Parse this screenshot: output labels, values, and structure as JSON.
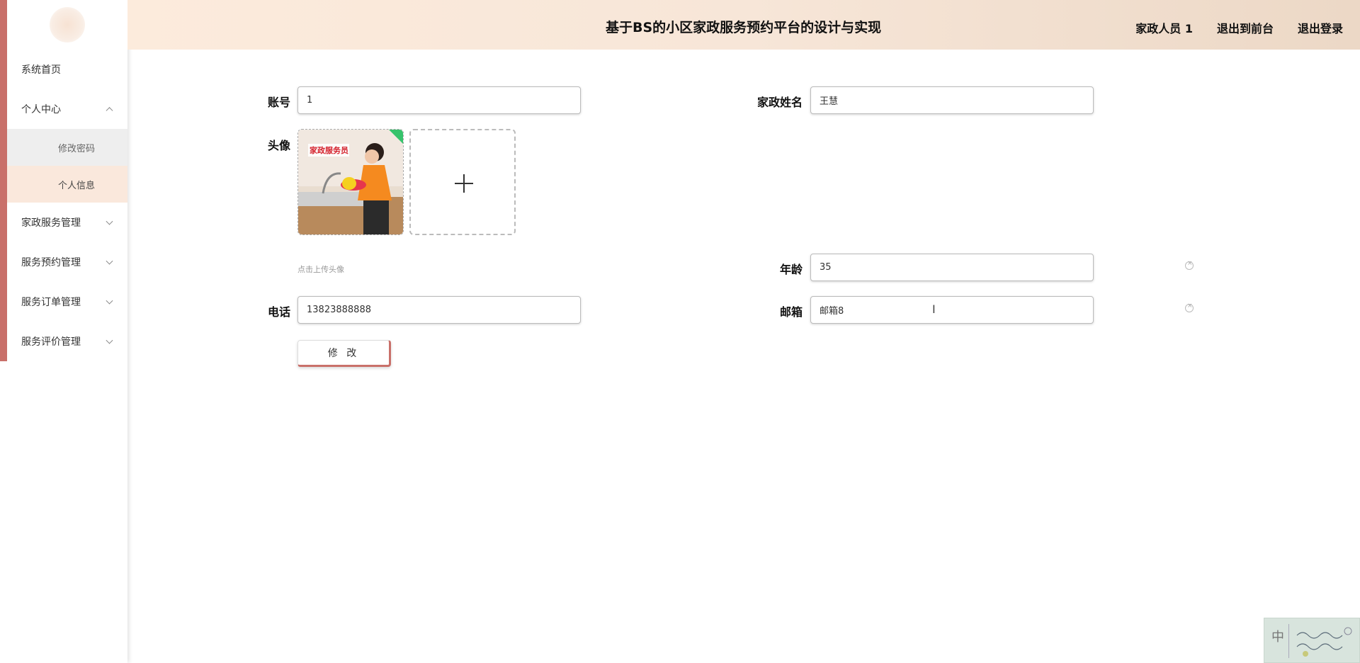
{
  "header": {
    "title": "基于BS的小区家政服务预约平台的设计与实现",
    "nav": [
      "家政人员 1",
      "退出到前台",
      "退出登录"
    ]
  },
  "sidebar": {
    "items": [
      {
        "label": "系统首页",
        "icon": "none"
      },
      {
        "label": "个人中心",
        "icon": "chevron-up-icon"
      },
      {
        "label": "家政服务管理",
        "icon": "chevron-down-icon"
      },
      {
        "label": "服务预约管理",
        "icon": "chevron-down-icon"
      },
      {
        "label": "服务订单管理",
        "icon": "chevron-down-icon"
      },
      {
        "label": "服务评价管理",
        "icon": "chevron-down-icon"
      }
    ],
    "sub_items": [
      {
        "label": "修改密码"
      },
      {
        "label": "个人信息"
      }
    ]
  },
  "form": {
    "account_label": "账号",
    "account_value": "1",
    "name_label": "家政姓名",
    "name_value": "王慧",
    "avatar_label": "头像",
    "avatar_caption": "家政服务员",
    "avatar_hint": "点击上传头像",
    "age_label": "年龄",
    "age_value": "35",
    "phone_label": "电话",
    "phone_value": "13823888888",
    "email_label": "邮箱",
    "email_value": "邮箱8",
    "submit_label": "修 改"
  },
  "ime": {
    "char": "中"
  },
  "colors": {
    "accent": "#c9706a",
    "header_gradient_start": "#fcebdc",
    "header_gradient_end": "#ecd8c6",
    "active_submenu": "#fae8dc"
  }
}
